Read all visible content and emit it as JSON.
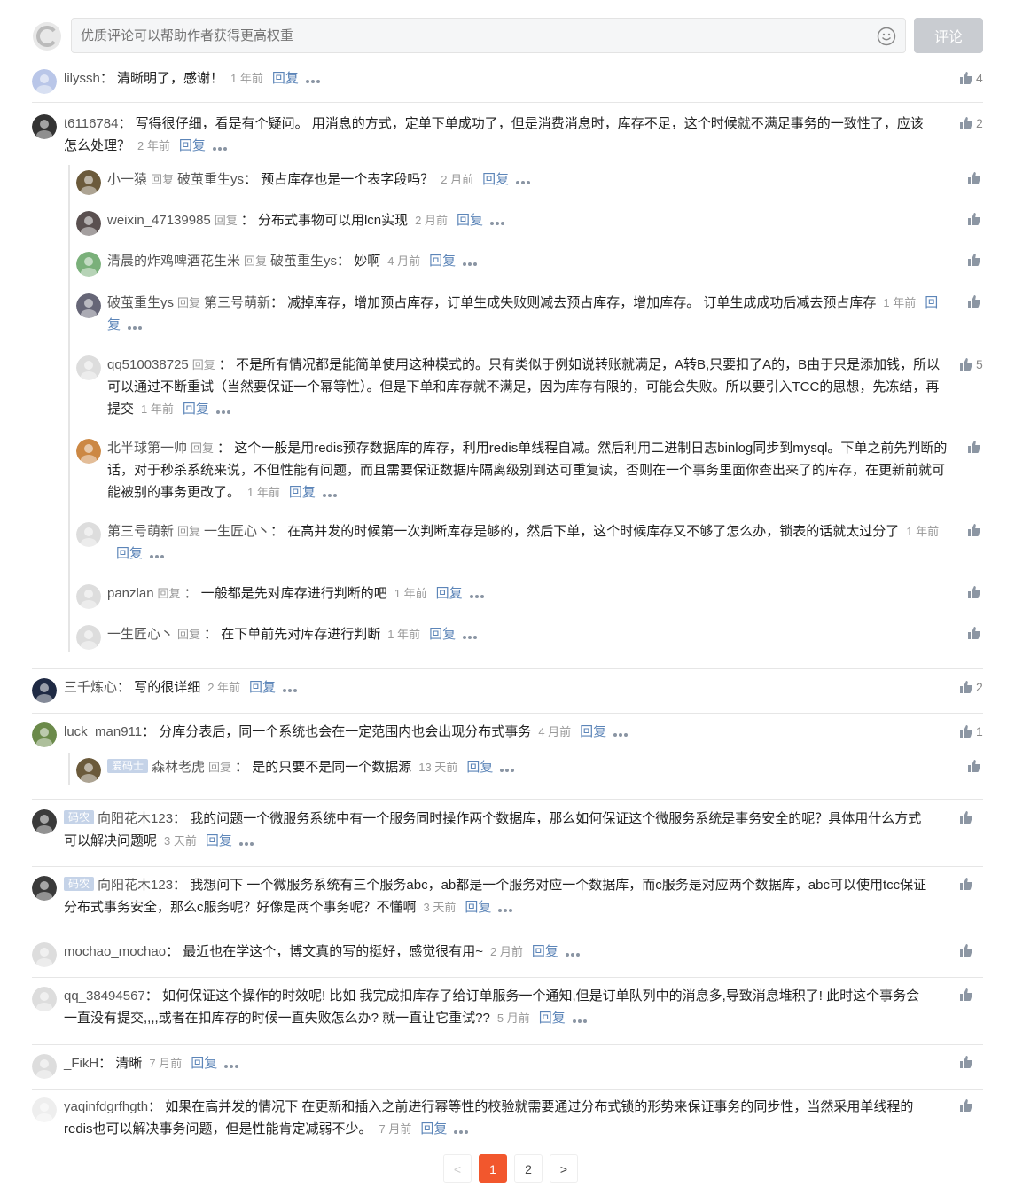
{
  "header": {
    "placeholder": "优质评论可以帮助作者获得更高权重",
    "submit": "评论"
  },
  "labels": {
    "reply": "回复",
    "reply_to": "回复",
    "tag": "码农"
  },
  "comments": [
    {
      "name": "lilyssh",
      "text": "清晰明了，感谢！",
      "time": "1 年前",
      "likes": "4"
    },
    {
      "name": "t6116784",
      "text": "写得很仔细，看是有个疑问。 用消息的方式，定单下单成功了，但是消费消息时，库存不足，这个时候就不满足事务的一致性了，应该怎么处理？",
      "time": "2 年前",
      "likes": "2",
      "replies": [
        {
          "name": "小一猿",
          "to": "破茧重生ys",
          "text": "预占库存也是一个表字段吗？",
          "time": "2 月前"
        },
        {
          "name": "weixin_47139985",
          "to": "",
          "text": "分布式事物可以用lcn实现",
          "time": "2 月前"
        },
        {
          "name": "清晨的炸鸡啤酒花生米",
          "to": "破茧重生ys",
          "text": "妙啊",
          "time": "4 月前"
        },
        {
          "name": "破茧重生ys",
          "to": "第三号萌新",
          "text": "减掉库存，增加预占库存，订单生成失败则减去预占库存，增加库存。 订单生成成功后减去预占库存",
          "time": "1 年前"
        },
        {
          "name": "qq510038725",
          "to": "",
          "text": "不是所有情况都是能简单使用这种模式的。只有类似于例如说转账就满足，A转B,只要扣了A的，B由于只是添加钱，所以可以通过不断重试（当然要保证一个幂等性）。但是下单和库存就不满足，因为库存有限的，可能会失败。所以要引入TCC的思想，先冻结，再提交",
          "time": "1 年前",
          "likes": "5"
        },
        {
          "name": "北半球第一帅",
          "to": "",
          "text": "这个一般是用redis预存数据库的库存，利用redis单线程自减。然后利用二进制日志binlog同步到mysql。下单之前先判断的话，对于秒杀系统来说，不但性能有问题，而且需要保证数据库隔离级别到达可重复读，否则在一个事务里面你查出来了的库存，在更新前就可能被别的事务更改了。",
          "time": "1 年前"
        },
        {
          "name": "第三号萌新",
          "to": "一生匠心丶",
          "text": "在高并发的时候第一次判断库存是够的，然后下单，这个时候库存又不够了怎么办，锁表的话就太过分了",
          "time": "1 年前"
        },
        {
          "name": "panzlan",
          "to": "",
          "text": "一般都是先对库存进行判断的吧",
          "time": "1 年前"
        },
        {
          "name": "一生匠心丶",
          "to": "",
          "text": "在下单前先对库存进行判断",
          "time": "1 年前"
        }
      ]
    },
    {
      "name": "三千炼心",
      "text": "写的很详细",
      "time": "2 年前",
      "likes": "2"
    },
    {
      "name": "luck_man911",
      "text": "分库分表后，同一个系统也会在一定范围内也会出现分布式事务",
      "time": "4 月前",
      "likes": "1",
      "replies": [
        {
          "name": "森林老虎",
          "tag": "爱码士",
          "to": "",
          "text": "是的只要不是同一个数据源",
          "time": "13 天前"
        }
      ]
    },
    {
      "name": "向阳花木123",
      "tag": "码农",
      "text": "我的问题一个微服务系统中有一个服务同时操作两个数据库，那么如何保证这个微服务系统是事务安全的呢？具体用什么方式可以解决问题呢",
      "time": "3 天前"
    },
    {
      "name": "向阳花木123",
      "tag": "码农",
      "text": "我想问下 一个微服务系统有三个服务abc，ab都是一个服务对应一个数据库，而c服务是对应两个数据库，abc可以使用tcc保证分布式事务安全，那么c服务呢？好像是两个事务呢？不懂啊",
      "time": "3 天前"
    },
    {
      "name": "mochao_mochao",
      "text": "最近也在学这个，博文真的写的挺好，感觉很有用~",
      "time": "2 月前"
    },
    {
      "name": "qq_38494567",
      "text": "如何保证这个操作的时效呢! 比如 我完成扣库存了给订单服务一个通知,但是订单队列中的消息多,导致消息堆积了! 此时这个事务会一直没有提交,,,,或者在扣库存的时候一直失败怎么办? 就一直让它重试??",
      "time": "5 月前"
    },
    {
      "name": "_FikH",
      "text": "清晰",
      "time": "7 月前"
    },
    {
      "name": "yaqinfdgrfhgth",
      "text": "如果在高并发的情况下 在更新和插入之前进行幂等性的校验就需要通过分布式锁的形势来保证事务的同步性，当然采用单线程的redis也可以解决事务问题，但是性能肯定减弱不少。",
      "time": "7 月前"
    }
  ],
  "pagination": {
    "prev": "<",
    "pages": [
      "1",
      "2"
    ],
    "next": ">"
  }
}
